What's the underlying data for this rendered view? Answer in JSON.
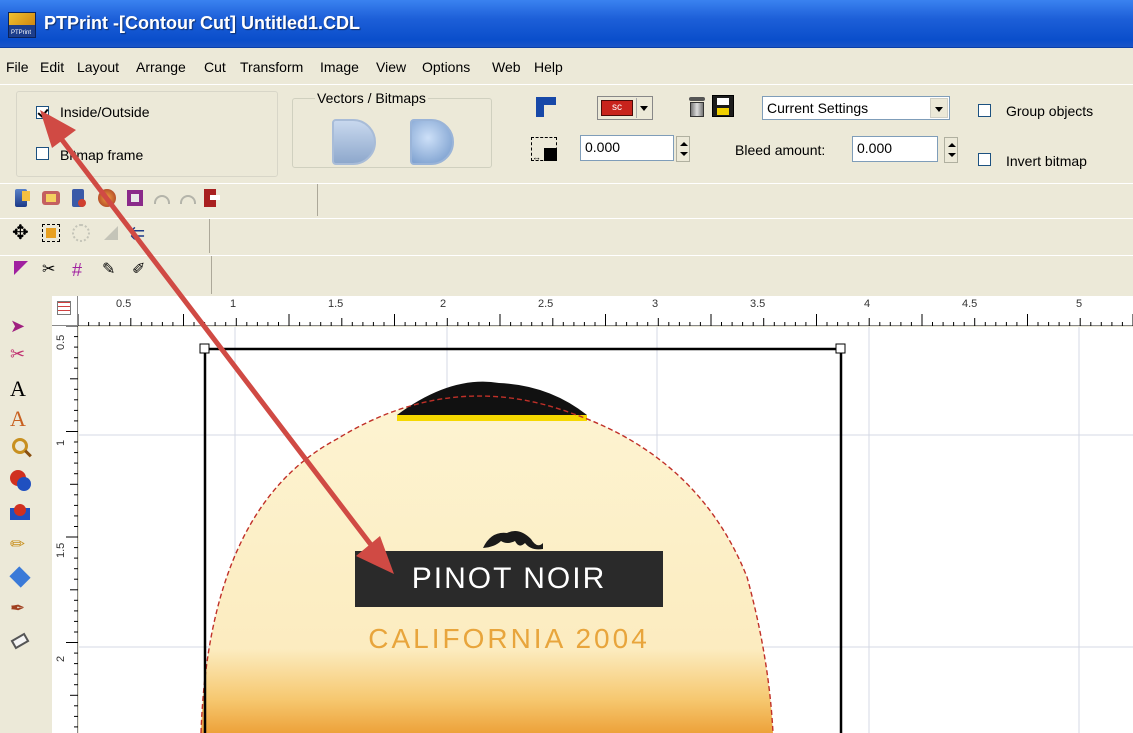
{
  "window": {
    "title": "PTPrint -[Contour Cut] Untitled1.CDL",
    "app_icon_text": "PTPrint"
  },
  "menu": [
    "File",
    "Edit",
    "Layout",
    "Arrange",
    "Cut",
    "Transform",
    "Image",
    "View",
    "Options",
    "Web",
    "Help"
  ],
  "props": {
    "inside_outside_label": "Inside/Outside",
    "inside_outside_checked": true,
    "bitmap_frame_label": "Bitmap frame",
    "bitmap_frame_checked": false,
    "vectors_bitmaps_title": "Vectors / Bitmaps",
    "offset_value": "0.000",
    "color_swatch_text": "sc",
    "settings_value": "Current Settings",
    "bleed_label": "Bleed amount:",
    "bleed_value": "0.000",
    "group_objects_label": "Group objects",
    "group_objects_checked": false,
    "invert_bitmap_label": "Invert bitmap",
    "invert_bitmap_checked": false
  },
  "ruler": {
    "h_labels": [
      "0.5",
      "1",
      "1.5",
      "2",
      "2.5",
      "3",
      "3.5",
      "4",
      "4.5",
      "5"
    ],
    "v_labels": [
      "0.5",
      "1",
      "1.5",
      "2"
    ]
  },
  "artwork": {
    "heading": "PINOT NOIR",
    "subheading": "CALIFORNIA 2004"
  },
  "colors": {
    "title_bar": "#0a4ecb",
    "arrow": "#d04a44",
    "label_bg": "#2a2a2a",
    "label_text_gold": "#e8a53c",
    "cream": "#fdf2cc",
    "yellow_band": "#f5d800"
  }
}
